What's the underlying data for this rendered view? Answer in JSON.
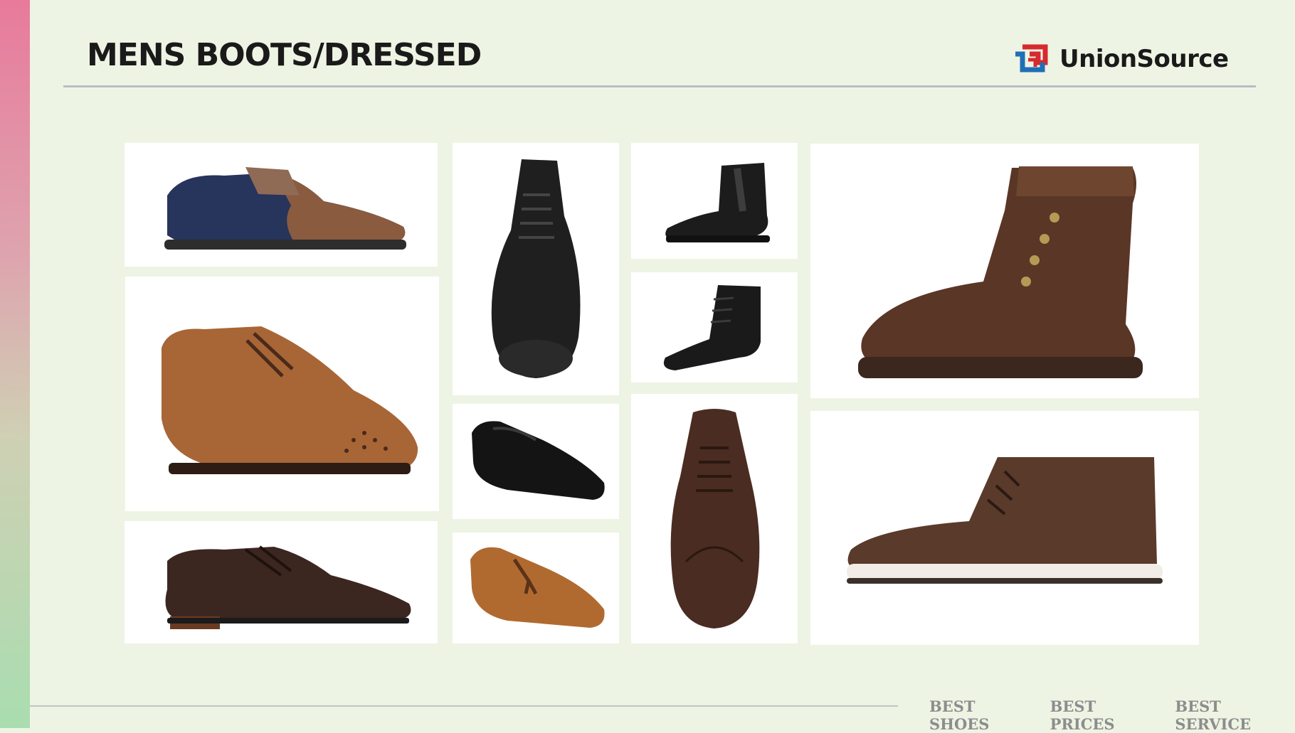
{
  "header": {
    "title": "MENS BOOTS/DRESSED",
    "brand": "UnionSource"
  },
  "footer": {
    "taglines": [
      "BEST SHOES",
      "BEST PRICES",
      "BEST SERVICE"
    ]
  },
  "colors": {
    "background": "#eef4e4",
    "accent_red": "#d72a2f",
    "accent_blue": "#1f6fb6",
    "rule": "#b9bdc2"
  },
  "products": [
    {
      "name": "Navy suede brogue oxford",
      "icon": "oxford-shoe-icon",
      "upper": "#27345c",
      "accent": "#8a5b3f"
    },
    {
      "name": "Black chukka boot",
      "icon": "chukka-boot-front-icon",
      "upper": "#1f1f1f"
    },
    {
      "name": "Black chelsea boot",
      "icon": "chelsea-boot-icon",
      "upper": "#1c1c1c"
    },
    {
      "name": "Brown lace-up work boot",
      "icon": "work-boot-icon",
      "upper": "#5a3626"
    },
    {
      "name": "Tan wingtip brogue",
      "icon": "wingtip-shoe-icon",
      "upper": "#a86536"
    },
    {
      "name": "Black nubuck lace-up boot",
      "icon": "lace-boot-icon",
      "upper": "#1a1a1a"
    },
    {
      "name": "Black slip-on loafer",
      "icon": "slip-on-shoe-icon",
      "upper": "#141414"
    },
    {
      "name": "Brown wingtip derby front",
      "icon": "derby-front-icon",
      "upper": "#4a2c22"
    },
    {
      "name": "Dark brown cap-toe derby",
      "icon": "derby-shoe-icon",
      "upper": "#3c2620"
    },
    {
      "name": "Tan tassel loafer",
      "icon": "tassel-loafer-icon",
      "upper": "#b06a30"
    },
    {
      "name": "Brown chukka sneaker boot",
      "icon": "sneaker-boot-icon",
      "upper": "#5a3a2a"
    }
  ]
}
